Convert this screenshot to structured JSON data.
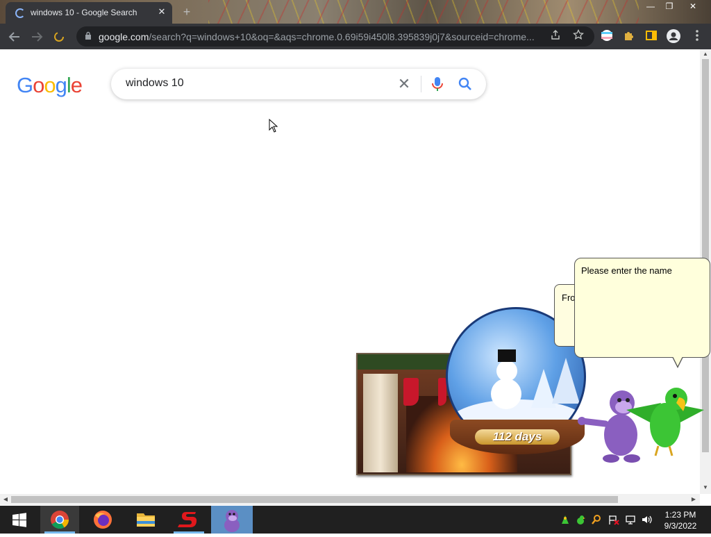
{
  "browser": {
    "tab": {
      "title": "windows 10 - Google Search",
      "close": "✕"
    },
    "new_tab": "+",
    "window_controls": {
      "minimize": "—",
      "restore": "❐",
      "close": "✕"
    },
    "url_host": "google.com",
    "url_rest": "/search?q=windows+10&oq=&aqs=chrome.0.69i59i450l8.395839j0j7&sourceid=chrome...",
    "icons": [
      "back-icon",
      "forward-icon",
      "loading-stop-icon",
      "lock-icon",
      "share-icon",
      "star-icon",
      "extension-flag-icon",
      "puzzle-icon",
      "sidepanel-icon",
      "profile-icon",
      "menu-icon"
    ]
  },
  "page": {
    "logo": {
      "G": "G",
      "o1": "o",
      "o2": "o",
      "g": "g",
      "l": "l",
      "e": "e"
    },
    "search": {
      "query": "windows 10",
      "clear": "✕"
    }
  },
  "overlay": {
    "bubble_back_text": "Fro",
    "bubble_text": "Please enter the name",
    "countdown": "112 days"
  },
  "taskbar": {
    "apps": [
      "start-icon",
      "chrome-icon",
      "firefox-icon",
      "file-explorer-icon",
      "s-app-icon",
      "bonzibuddy-icon"
    ],
    "clock_time": "1:23 PM",
    "clock_date": "9/3/2022"
  },
  "colors": {
    "google_blue": "#4285F4",
    "google_red": "#EA4335",
    "google_yellow": "#FBBC05",
    "google_green": "#34A853",
    "chrome_dark": "#35363a",
    "taskbar": "#202020",
    "bubble": "#ffffdc"
  }
}
